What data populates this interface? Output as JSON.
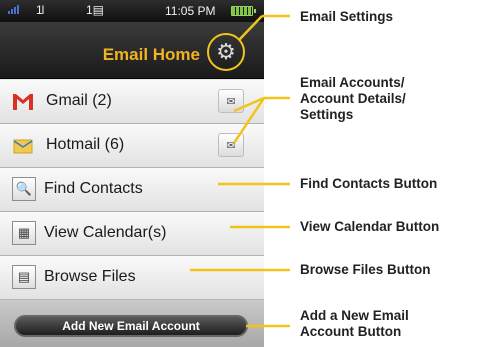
{
  "status_bar": {
    "signal_icon": "signal-bars-icon",
    "data_icon": "data-arrows-icon",
    "data_text": "1l",
    "message_icon": "message-indicator-icon",
    "message_text": "1▤",
    "time": "11:05 PM",
    "battery_icon": "battery-icon"
  },
  "header": {
    "title": "Email Home",
    "settings_icon": "gear-icon"
  },
  "accounts": [
    {
      "label": "Gmail (2)",
      "icon": "gmail-icon",
      "button_icon": "envelope-gear-icon"
    },
    {
      "label": "Hotmail (6)",
      "icon": "hotmail-icon",
      "button_icon": "envelope-gear-icon"
    }
  ],
  "tools": [
    {
      "label": "Find Contacts",
      "icon": "find-contacts-icon",
      "glyph": "🔍"
    },
    {
      "label": "View Calendar(s)",
      "icon": "calendar-icon",
      "glyph": "▦"
    },
    {
      "label": "Browse Files",
      "icon": "file-icon",
      "glyph": "▤"
    }
  ],
  "footer": {
    "add_account_label": "Add New Email Account"
  },
  "callouts": {
    "email_settings": "Email Settings",
    "account_details": [
      "Email Accounts/",
      "Account Details/",
      "Settings"
    ],
    "find_contacts": "Find Contacts Button",
    "view_calendar": "View Calendar Button",
    "browse_files": "Browse Files Button",
    "add_account": [
      "Add a New Email",
      "Account Button"
    ]
  },
  "colors": {
    "accent_yellow": "#f0c51b",
    "header_text": "#f0b322",
    "gmail_red": "#d93025"
  }
}
